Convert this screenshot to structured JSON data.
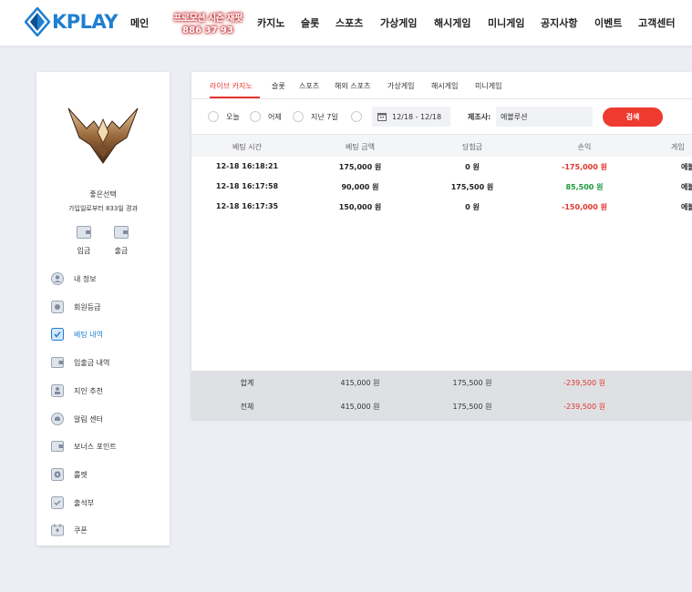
{
  "header": {
    "logo_text": "KPLAY",
    "nav": [
      {
        "label": "메인"
      },
      {
        "label": "카지노"
      },
      {
        "label": "슬롯"
      },
      {
        "label": "스포츠"
      },
      {
        "label": "가상게임"
      },
      {
        "label": "해시게임"
      },
      {
        "label": "미니게임"
      },
      {
        "label": "공지사항"
      },
      {
        "label": "이벤트"
      },
      {
        "label": "고객센터"
      }
    ],
    "promo_line1": "프로모션 시즌 재팟",
    "promo_line2": "886 37 93"
  },
  "sidebar": {
    "user_name": "좋은선택",
    "user_since": "가입일로부터 833일 경과",
    "deposit_label": "입금",
    "withdraw_label": "출금",
    "menu": [
      {
        "label": "내 정보",
        "icon": "user-icon"
      },
      {
        "label": "회원등급",
        "icon": "badge-icon"
      },
      {
        "label": "베팅 내역",
        "icon": "betting-history-icon",
        "active": true
      },
      {
        "label": "입출금 내역",
        "icon": "wallet-icon"
      },
      {
        "label": "지인 추천",
        "icon": "referral-icon"
      },
      {
        "label": "알림 센터",
        "icon": "bell-icon"
      },
      {
        "label": "보너스 포인트",
        "icon": "points-icon"
      },
      {
        "label": "룰렛",
        "icon": "roulette-icon"
      },
      {
        "label": "출석부",
        "icon": "attendance-icon"
      },
      {
        "label": "쿠폰",
        "icon": "coupon-icon"
      }
    ]
  },
  "tabs": [
    {
      "label": "라이브 카지노",
      "active": true
    },
    {
      "label": "슬롯"
    },
    {
      "label": "스포츠"
    },
    {
      "label": "해외 스포츠"
    },
    {
      "label": "가상게임"
    },
    {
      "label": "해시게임"
    },
    {
      "label": "미니게임"
    }
  ],
  "filters": {
    "radios": [
      {
        "label": "오늘"
      },
      {
        "label": "어제"
      },
      {
        "label": "지난 7일"
      },
      {
        "label": ""
      }
    ],
    "date_range": "12/18 - 12/18",
    "vendor_label": "제조사:",
    "vendor_value": "에볼루션",
    "search_label": "검색"
  },
  "table": {
    "columns": [
      "베팅 시간",
      "베팅 금액",
      "당첨금",
      "손익",
      "게임"
    ],
    "rows": [
      {
        "time": "12-18 16:18:21",
        "bet": "175,000 원",
        "win": "0 원",
        "profit": "-175,000 원",
        "profit_sign": "neg",
        "game": "에볼"
      },
      {
        "time": "12-18 16:17:58",
        "bet": "90,000 원",
        "win": "175,500 원",
        "profit": "85,500 원",
        "profit_sign": "pos",
        "game": "에볼"
      },
      {
        "time": "12-18 16:17:35",
        "bet": "150,000 원",
        "win": "0 원",
        "profit": "-150,000 원",
        "profit_sign": "neg",
        "game": "에볼"
      }
    ],
    "summary": [
      {
        "label": "합계",
        "bet": "415,000 원",
        "win": "175,500 원",
        "profit": "-239,500 원"
      },
      {
        "label": "전체",
        "bet": "415,000 원",
        "win": "175,500 원",
        "profit": "-239,500 원"
      }
    ]
  },
  "colors": {
    "brand": "#1f7fd0",
    "accent": "#ee3a2f",
    "loss": "#e0332b",
    "gain": "#1a9a3a"
  }
}
